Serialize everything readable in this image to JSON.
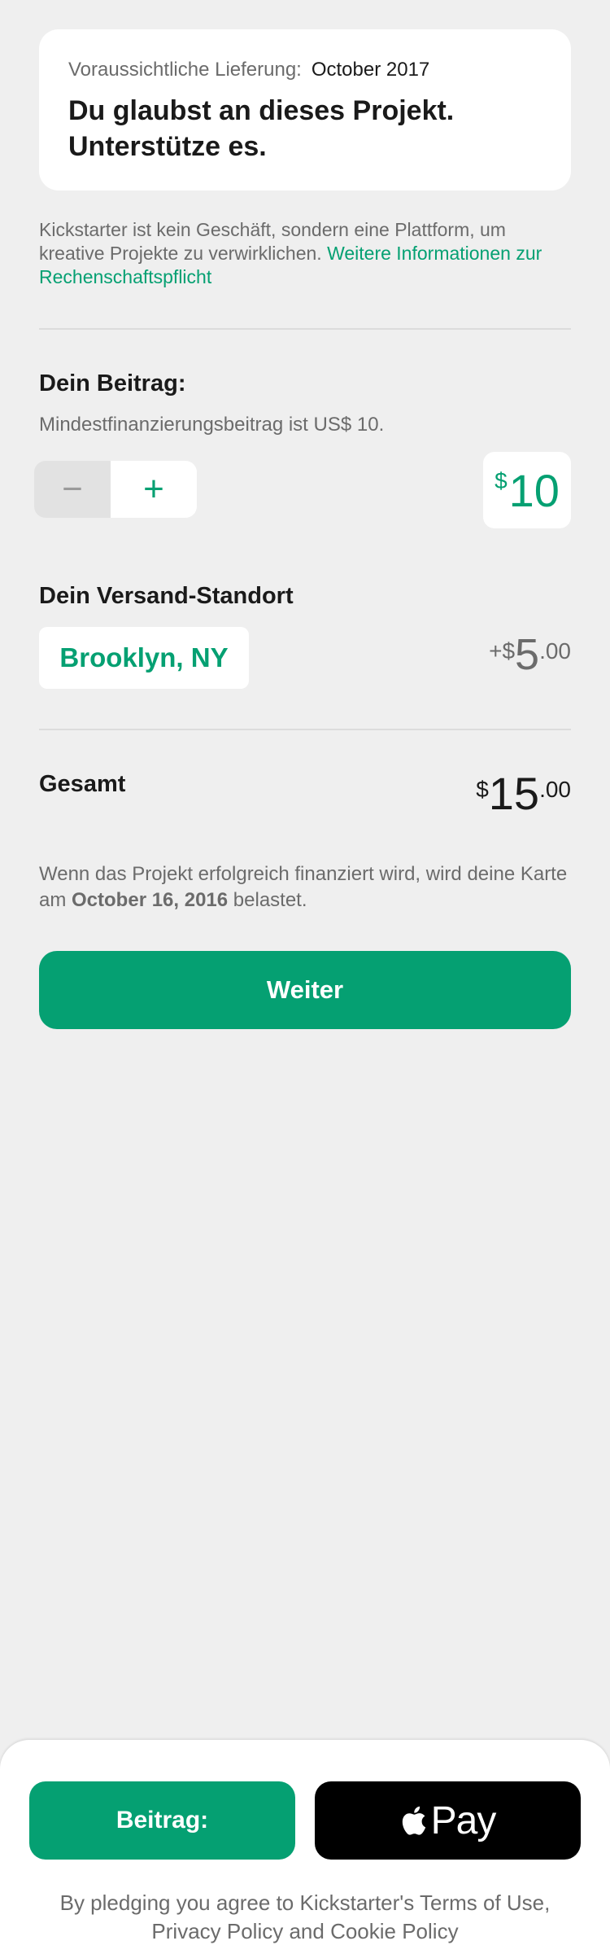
{
  "delivery": {
    "label": "Voraussichtliche Lieferung:",
    "value": "October 2017"
  },
  "card": {
    "title_line1": "Du glaubst an dieses Projekt.",
    "title_line2": "Unterstütze es."
  },
  "info": {
    "text": "Kickstarter ist kein Geschäft, sondern eine Plattform, um kreative Projekte zu verwirklichen. ",
    "link": "Weitere Informationen zur Rechenschaftspflicht"
  },
  "pledge": {
    "title": "Dein Beitrag:",
    "min_note": "Mindestfinanzierungsbeitrag ist US$ 10.",
    "minus_icon": "minus-icon",
    "plus_icon": "plus-icon",
    "minus_symbol": "−",
    "plus_symbol": "+",
    "currency": "$",
    "amount": "10"
  },
  "shipping": {
    "title": "Dein Versand-Standort",
    "location": "Brooklyn, NY",
    "plus": "+",
    "currency": "$",
    "amount": "5",
    "cents": ".00"
  },
  "total": {
    "label": "Gesamt",
    "currency": "$",
    "amount": "15",
    "cents": ".00"
  },
  "charge_note": {
    "prefix": "Wenn das Projekt erfolgreich finanziert wird, wird deine Karte am ",
    "date": "October 16, 2016",
    "suffix": " belastet."
  },
  "continue_button": "Weiter",
  "bottom": {
    "pledge_button": "Beitrag:",
    "applepay_icon": "apple-logo-icon",
    "applepay_label": "Pay",
    "terms": "By pledging you agree to Kickstarter's Terms of Use, Privacy Policy and Cookie Policy"
  },
  "colors": {
    "accent": "#05a072",
    "background": "#efefef",
    "card": "#ffffff",
    "secondary_text": "#6b6b6b",
    "applepay": "#000000"
  }
}
